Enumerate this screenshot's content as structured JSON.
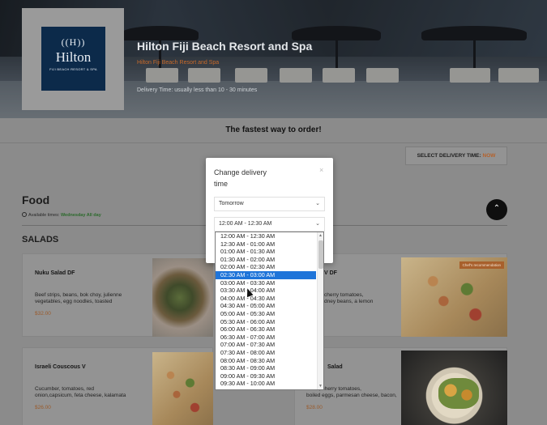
{
  "hotel": {
    "logo_mark": "((H))",
    "logo_brand": "Hilton",
    "logo_sub": "FIJI BEACH RESORT & SPA",
    "name": "Hilton Fiji Beach Resort and Spa",
    "subtitle": "Hilton Fiji Beach Resort and Spa",
    "delivery_time": "Delivery Time: usually less than 10 - 30 minutes"
  },
  "tagline": "The fastest way to order!",
  "delivery_button": {
    "label": "SELECT DELIVERY TIME:",
    "value": "NOW"
  },
  "menu": {
    "section_title": "Food",
    "availability_label": "Available times:",
    "availability_value": "Wednesday All day",
    "category": "SALADS",
    "items": [
      {
        "name": "Nuku Salad DF",
        "desc_1": "Beef strips, beans, bok choy, julienne",
        "desc_2": "vegetables, egg noodles, toasted",
        "price": "$32.00"
      },
      {
        "name": "V DF",
        "desc_1": "cherry tomatoes,",
        "desc_2": "dney beans, a lemon",
        "price": ""
      },
      {
        "name": "Israeli Couscous V",
        "desc_1": "Cucumber, tomatoes, red",
        "desc_2": "onion,capsicum, feta cheese, kalamata",
        "price": "$26.00"
      },
      {
        "name": "Salad",
        "desc_1": "utons, cherry tomatoes,",
        "desc_2": "boiled eggs, parmesan cheese, bacon,",
        "price": "$28.00"
      }
    ],
    "badge": "Chef's recommendation"
  },
  "modal": {
    "title": "Change delivery time",
    "close_icon": "close-icon",
    "day_select": "Tomorrow",
    "time_select": "12:00 AM - 12:30 AM"
  },
  "dropdown": {
    "selected_index": 5,
    "options": [
      "12:00 AM - 12:30 AM",
      "12:30 AM - 01:00 AM",
      "01:00 AM - 01:30 AM",
      "01:30 AM - 02:00 AM",
      "02:00 AM - 02:30 AM",
      "02:30 AM - 03:00 AM",
      "03:00 AM - 03:30 AM",
      "03:30 AM - 04:00 AM",
      "04:00 AM - 04:30 AM",
      "04:30 AM - 05:00 AM",
      "05:00 AM - 05:30 AM",
      "05:30 AM - 06:00 AM",
      "06:00 AM - 06:30 AM",
      "06:30 AM - 07:00 AM",
      "07:00 AM - 07:30 AM",
      "07:30 AM - 08:00 AM",
      "08:00 AM - 08:30 AM",
      "08:30 AM - 09:00 AM",
      "09:00 AM - 09:30 AM",
      "09:30 AM - 10:00 AM"
    ]
  },
  "icons": {
    "chevron": "chevron-down-icon",
    "scroll_top": "chevron-up-icon",
    "clock": "clock-icon"
  }
}
